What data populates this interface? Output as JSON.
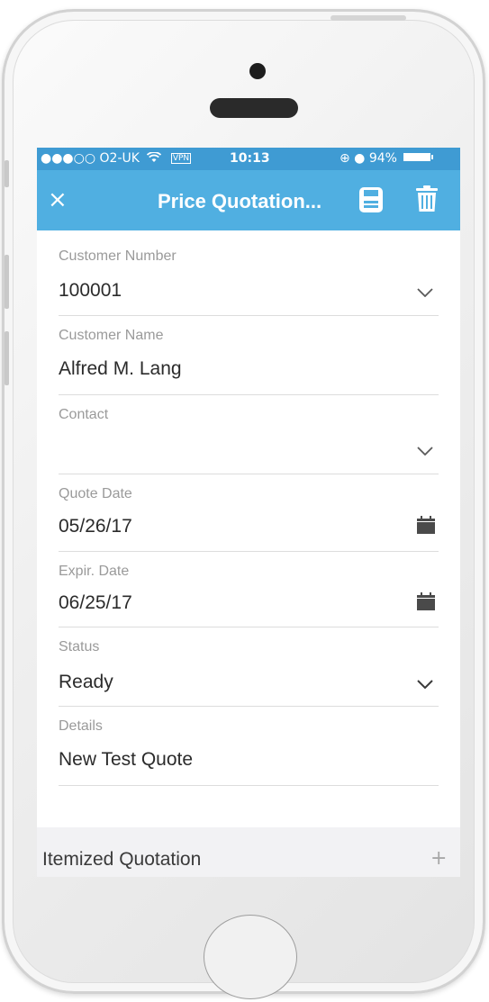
{
  "status_bar": {
    "carrier": "●●●○○ O2-UK",
    "wifi_icon": "wifi-icon",
    "vpn": "VPN",
    "time": "10:13",
    "alarm_icons": "⊕ ●",
    "battery": "94%"
  },
  "navbar": {
    "close": "×",
    "title": "Price Quotation...",
    "save_icon": "save-icon",
    "trash_icon": "trash-icon",
    "background": "#50afe1"
  },
  "fields": {
    "customer_number": {
      "label": "Customer Number",
      "value": "100001"
    },
    "customer_name": {
      "label": "Customer Name",
      "value": "Alfred M. Lang"
    },
    "contact": {
      "label": "Contact",
      "value": ""
    },
    "quote_date": {
      "label": "Quote Date",
      "value": "05/26/17"
    },
    "expir_date": {
      "label": "Expir. Date",
      "value": "06/25/17"
    },
    "status": {
      "label": "Status",
      "value": "Ready"
    },
    "details": {
      "label": "Details",
      "value": "New Test Quote"
    }
  },
  "itemized": {
    "title": "Itemized Quotation",
    "add": "+"
  }
}
